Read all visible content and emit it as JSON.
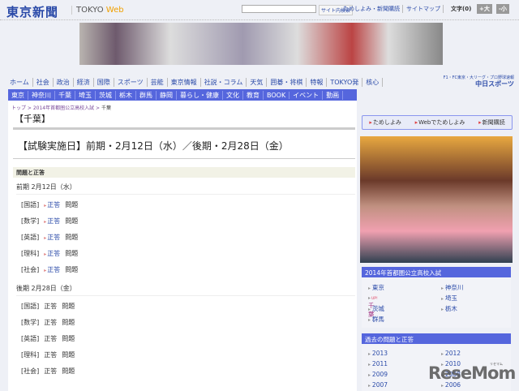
{
  "header": {
    "logo": "東京新聞",
    "logo_sub_a": "TOKYO ",
    "logo_sub_b": "Web",
    "search_value": "",
    "search_button": "サイト内検索",
    "links": [
      "ためしよみ・新聞購読",
      "サイトマップ"
    ],
    "font_size_label": "文字(0)",
    "font_larger": "+大",
    "font_smaller": "-小"
  },
  "nav_primary": [
    "ホーム",
    "社会",
    "政治",
    "経済",
    "国際",
    "スポーツ",
    "芸能",
    "東京情報",
    "社説・コラム",
    "天気",
    "囲碁・将棋",
    "特報",
    "TOKYO発",
    "核心"
  ],
  "sports_link": {
    "line1": "F1・FC東京・大リーグ・プロ野球速報",
    "line2": "中日スポーツ"
  },
  "nav_regional": [
    "東京",
    "神奈川",
    "千葉",
    "埼玉",
    "茨城",
    "栃木",
    "群馬",
    "静岡",
    "暮らし・健康",
    "文化",
    "教育",
    "BOOK",
    "イベント",
    "動画"
  ],
  "breadcrumb": {
    "top": "トップ",
    "parent": "2014年首都圏公立高校入試",
    "current": "千葉",
    "sep": " > "
  },
  "page_heading": "【千葉】",
  "exam_dates": "【試験実施日】前期・2月12日（水）／後期・2月28日（金）",
  "section_title": "問題と正答",
  "periods": [
    {
      "label": "前期 2月12日（水）",
      "rows": [
        {
          "subject": "[国語]",
          "answer": "正答",
          "problem": "問題"
        },
        {
          "subject": "[数学]",
          "answer": "正答",
          "problem": "問題"
        },
        {
          "subject": "[英語]",
          "answer": "正答",
          "problem": "問題"
        },
        {
          "subject": "[理科]",
          "answer": "正答",
          "problem": "問題"
        },
        {
          "subject": "[社会]",
          "answer": "正答",
          "problem": "問題"
        }
      ]
    },
    {
      "label": "後期 2月28日（金）",
      "rows": [
        {
          "subject": "[国語]",
          "answer": "正答",
          "problem": "問題"
        },
        {
          "subject": "[数学]",
          "answer": "正答",
          "problem": "問題"
        },
        {
          "subject": "[英語]",
          "answer": "正答",
          "problem": "問題"
        },
        {
          "subject": "[理科]",
          "answer": "正答",
          "problem": "問題"
        },
        {
          "subject": "[社会]",
          "answer": "正答",
          "problem": "問題"
        }
      ]
    }
  ],
  "sidebar": {
    "buttons": [
      "ためしよみ",
      "Webでためしよみ",
      "新聞購読"
    ],
    "exam_title": "2014年首都圏公立高校入試",
    "prefectures": [
      "東京",
      "神奈川",
      "千葉",
      "埼玉",
      "茨城",
      "栃木",
      "群馬"
    ],
    "up_badge": "UP!",
    "past_title": "過去の問題と正答",
    "years": [
      "2013",
      "2012",
      "2011",
      "2010",
      "2009",
      "2008",
      "2007",
      "2006"
    ]
  },
  "watermark": {
    "text": "ReseMom",
    "sub": "リセマム"
  }
}
